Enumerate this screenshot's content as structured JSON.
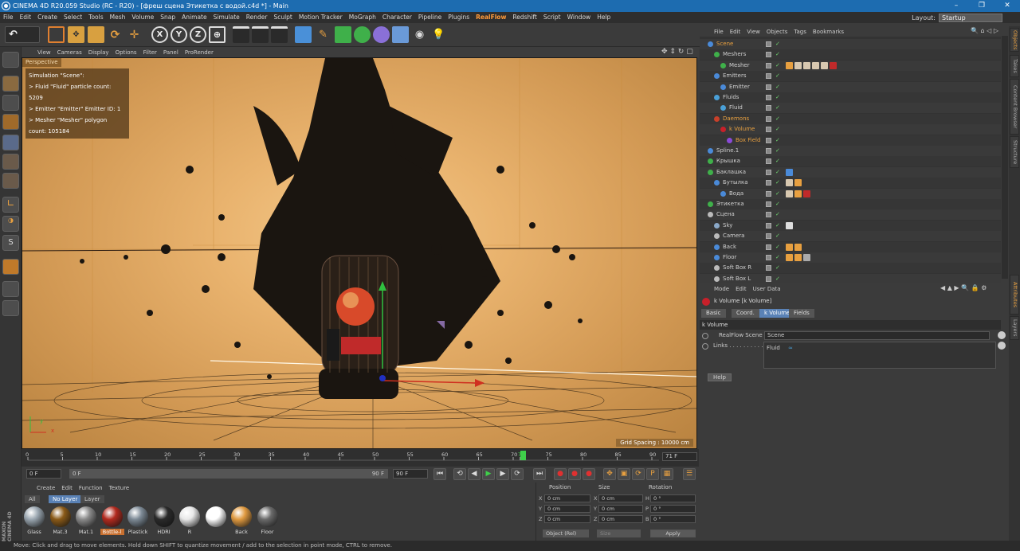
{
  "window": {
    "title": "CINEMA 4D R20.059 Studio (RC - R20) - [фреш сцена  Этикетка с водой.c4d *] - Main",
    "controls": [
      "–",
      "❐",
      "✕"
    ]
  },
  "menu": [
    "File",
    "Edit",
    "Create",
    "Select",
    "Tools",
    "Mesh",
    "Volume",
    "Snap",
    "Animate",
    "Simulate",
    "Render",
    "Sculpt",
    "Motion Tracker",
    "MoGraph",
    "Character",
    "Pipeline",
    "Plugins",
    "RealFlow",
    "Redshift",
    "Script",
    "Window",
    "Help"
  ],
  "menu_highlight": "RealFlow",
  "layout": {
    "label": "Layout:",
    "value": "Startup"
  },
  "toolbar": {
    "axis_x": "X",
    "axis_y": "Y",
    "axis_z": "Z",
    "undo": "↶"
  },
  "viewport": {
    "menu": [
      "View",
      "Cameras",
      "Display",
      "Options",
      "Filter",
      "Panel",
      "ProRender"
    ],
    "label": "Perspective",
    "sim_lines": [
      "Simulation \"Scene\":",
      "  > Fluid \"Fluid\" particle count: 5209",
      "  > Emitter \"Emitter\" Emitter ID: 1",
      "  > Mesher \"Mesher\" polygon count: 105184"
    ],
    "grid_spacing": "Grid Spacing : 10000 cm",
    "axis_y": "y",
    "axis_x": "x",
    "accent": "#e8b06a"
  },
  "timeline": {
    "ticks": [
      "0",
      "5",
      "10",
      "15",
      "20",
      "25",
      "30",
      "35",
      "40",
      "45",
      "50",
      "55",
      "60",
      "65",
      "70",
      "71",
      "75",
      "80",
      "85",
      "90"
    ],
    "current_frame": "71",
    "frame_right": "71 F",
    "start": "0 F",
    "range_start": "0 F",
    "range_end": "90 F",
    "end": "90 F"
  },
  "materials": {
    "menu": [
      "Create",
      "Edit",
      "Function",
      "Texture"
    ],
    "tabs": [
      "All",
      "No Layer",
      "Layer"
    ],
    "items": [
      {
        "name": "Glass",
        "color": "#9aa6b0"
      },
      {
        "name": "Mat.3",
        "color": "#8a5a18"
      },
      {
        "name": "Mat.1",
        "color": "#8a8a8a"
      },
      {
        "name": "Bottle-l",
        "color": "#b22a1e"
      },
      {
        "name": "Plastick",
        "color": "#7d8a96"
      },
      {
        "name": "HDRI",
        "color": "#2a2a2a"
      },
      {
        "name": "R",
        "color": "#e8e8e8"
      },
      {
        "name": "",
        "color": "#ffffff"
      },
      {
        "name": "Back",
        "color": "#e09a40"
      },
      {
        "name": "Floor",
        "color": "#6a6a6a"
      }
    ]
  },
  "coordinates": {
    "headers": [
      "Position",
      "Size",
      "Rotation"
    ],
    "rows": [
      {
        "axis": "X",
        "pos": "0 cm",
        "size": "0 cm",
        "rlabel": "H",
        "rot": "0 °"
      },
      {
        "axis": "Y",
        "pos": "0 cm",
        "size": "0 cm",
        "rlabel": "P",
        "rot": "0 °"
      },
      {
        "axis": "Z",
        "pos": "0 cm",
        "size": "0 cm",
        "rlabel": "B",
        "rot": "0 °"
      }
    ],
    "mode": "Object (Rel)",
    "size_mode": "Size",
    "apply": "Apply"
  },
  "status": "Move: Click and drag to move elements. Hold down SHIFT to quantize movement / add to the selection in point mode, CTRL to remove.",
  "object_manager": {
    "menu": [
      "File",
      "Edit",
      "View",
      "Objects",
      "Tags",
      "Bookmarks"
    ],
    "objects": [
      {
        "name": "Scene",
        "indent": 0,
        "color": "#e8a040",
        "icon": "#4a8ad8"
      },
      {
        "name": "Meshers",
        "indent": 1,
        "color": "#cfcfcf",
        "icon": "#3fb04a"
      },
      {
        "name": "Mesher",
        "indent": 2,
        "color": "#cfcfcf",
        "icon": "#3fb04a"
      },
      {
        "name": "Emitters",
        "indent": 1,
        "color": "#cfcfcf",
        "icon": "#4a8ad8"
      },
      {
        "name": "Emitter",
        "indent": 2,
        "color": "#cfcfcf",
        "icon": "#4a8ad8"
      },
      {
        "name": "Fluids",
        "indent": 1,
        "color": "#cfcfcf",
        "icon": "#4aa0d8"
      },
      {
        "name": "Fluid",
        "indent": 2,
        "color": "#cfcfcf",
        "icon": "#4aa0d8"
      },
      {
        "name": "Daemons",
        "indent": 1,
        "color": "#e8a040",
        "icon": "#c8402a"
      },
      {
        "name": "k Volume",
        "indent": 2,
        "color": "#e8a040",
        "icon": "#c8202a"
      },
      {
        "name": "Box Field",
        "indent": 3,
        "color": "#e8a040",
        "icon": "#8a4ad8"
      },
      {
        "name": "Spline.1",
        "indent": 0,
        "color": "#cfcfcf",
        "icon": "#4a8ad8"
      },
      {
        "name": "Крышка",
        "indent": 0,
        "color": "#cfcfcf",
        "icon": "#3fb04a"
      },
      {
        "name": "Баклашка",
        "indent": 0,
        "color": "#cfcfcf",
        "icon": "#3fb04a"
      },
      {
        "name": "Бутылка",
        "indent": 1,
        "color": "#cfcfcf",
        "icon": "#4a8ad8"
      },
      {
        "name": "Вода",
        "indent": 2,
        "color": "#cfcfcf",
        "icon": "#4a8ad8"
      },
      {
        "name": "Этикетка",
        "indent": 0,
        "color": "#cfcfcf",
        "icon": "#3fb04a"
      },
      {
        "name": "Сцена",
        "indent": 0,
        "color": "#cfcfcf",
        "icon": "#bbbbbb"
      },
      {
        "name": "Sky",
        "indent": 1,
        "color": "#cfcfcf",
        "icon": "#8aa8c8"
      },
      {
        "name": "Camera",
        "indent": 1,
        "color": "#cfcfcf",
        "icon": "#bbbbbb"
      },
      {
        "name": "Back",
        "indent": 1,
        "color": "#cfcfcf",
        "icon": "#4a8ad8"
      },
      {
        "name": "Floor",
        "indent": 1,
        "color": "#cfcfcf",
        "icon": "#4a8ad8"
      },
      {
        "name": "Soft Box R",
        "indent": 1,
        "color": "#cfcfcf",
        "icon": "#bbbbbb"
      },
      {
        "name": "Soft Box L",
        "indent": 1,
        "color": "#cfcfcf",
        "icon": "#bbbbbb"
      }
    ]
  },
  "attribute_manager": {
    "menu": [
      "Mode",
      "Edit",
      "User Data"
    ],
    "object_title": "k Volume [k Volume]",
    "tabs": [
      "Basic",
      "Coord.",
      "k Volume",
      "Fields"
    ],
    "active_tab": "k Volume",
    "section": "k Volume",
    "realflow_label": "RealFlow Scene",
    "realflow_value": "Scene",
    "links_label": "Links . . . . . . . . . .",
    "links_value": "Fluid",
    "help": "Help"
  },
  "right_tabs": [
    "Objects",
    "Takes",
    "Content Browser",
    "Structure",
    "Attributes",
    "Layers"
  ]
}
